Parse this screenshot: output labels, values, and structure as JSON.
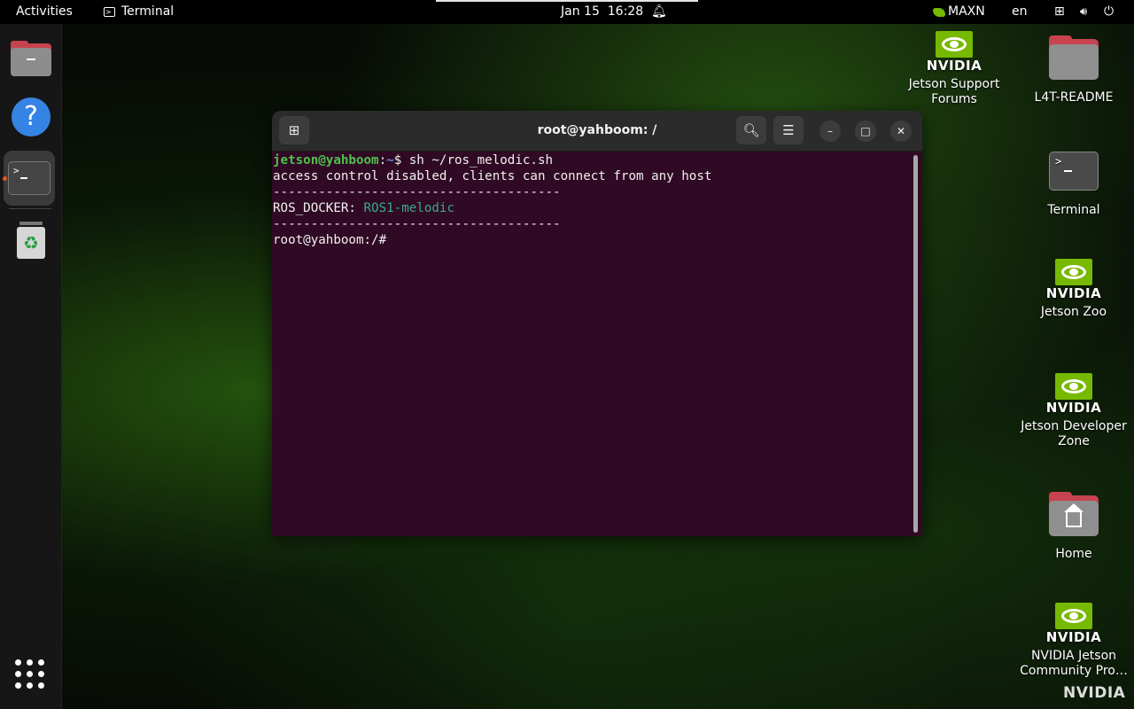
{
  "topbar": {
    "activities": "Activities",
    "app_name": "Terminal",
    "date": "Jan 15",
    "time": "16:28",
    "power_mode": "MAXN",
    "language": "en"
  },
  "desktop": {
    "icons": [
      {
        "label": "Jetson Support Forums"
      },
      {
        "label": "L4T-README"
      },
      {
        "label": "Terminal"
      },
      {
        "label": "Jetson Zoo"
      },
      {
        "label": "Jetson Developer Zone"
      },
      {
        "label": "Home"
      },
      {
        "label": "NVIDIA Jetson Community Pro…"
      }
    ],
    "logo_word": "NVIDIA"
  },
  "terminal": {
    "title": "root@yahboom: /",
    "lines": {
      "l1_user": "jetson@yahboom",
      "l1_sep": ":",
      "l1_path": "~",
      "l1_cmd": "$ sh ~/ros_melodic.sh",
      "l2": "access control disabled, clients can connect from any host",
      "l3": "--------------------------------------",
      "l4_key": "ROS_DOCKER: ",
      "l4_val": "ROS1-melodic",
      "l5": "--------------------------------------",
      "l6": "root@yahboom:/#"
    }
  },
  "colors": {
    "terminal_bg": "#300a24",
    "prompt_user": "#4ec14e",
    "prompt_path": "#5b8fd6",
    "highlight": "#3ea88a",
    "nvidia_green": "#76b900"
  }
}
